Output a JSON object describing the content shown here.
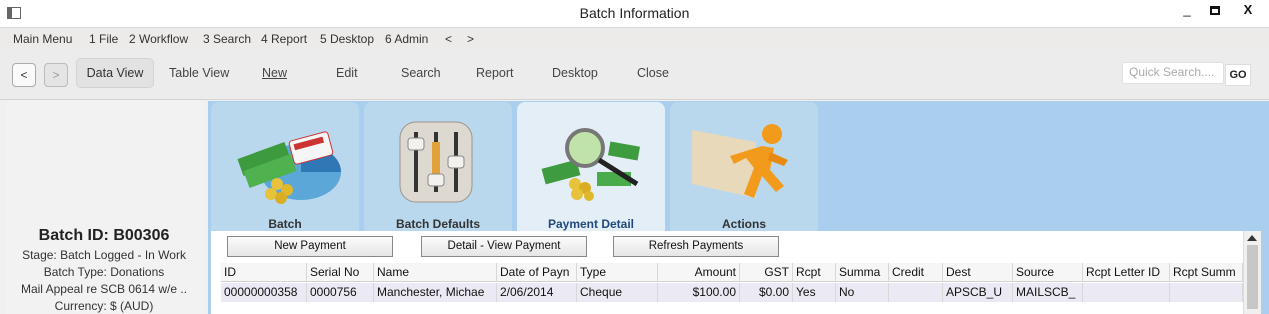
{
  "window": {
    "title": "Batch Information",
    "minimize": "_",
    "close": "X"
  },
  "menu": [
    "Main Menu",
    "1 File",
    "2 Workflow",
    "3 Search",
    "4 Report",
    "5 Desktop",
    "6 Admin",
    "<",
    ">"
  ],
  "toolbar": {
    "back": "<",
    "forward": ">",
    "data_view": "Data View",
    "table_view": "Table View",
    "new": "New",
    "edit": "Edit",
    "search": "Search",
    "report": "Report",
    "desktop": "Desktop",
    "close": "Close",
    "quick_search_placeholder": "Quick Search....",
    "go": "GO"
  },
  "batch_summary": {
    "batch_id": "Batch ID: B00306",
    "stage": "Stage: Batch Logged - In Work",
    "batch_type": "Batch Type: Donations",
    "description": "Mail Appeal re SCB 0614 w/e ..",
    "currency": "Currency: $ (AUD)"
  },
  "tabs": [
    {
      "label": "Batch",
      "icon": "money-card-icon"
    },
    {
      "label": "Batch Defaults",
      "icon": "sliders-icon"
    },
    {
      "label": "Payment Detail",
      "icon": "magnifier-money-icon",
      "active": true
    },
    {
      "label": "Actions",
      "icon": "running-man-icon"
    }
  ],
  "actions": {
    "new_payment": "New Payment",
    "detail_view": "Detail - View Payment",
    "refresh": "Refresh Payments"
  },
  "grid": {
    "columns": [
      "ID",
      "Serial No",
      "Name",
      "Date of Payn",
      "Type",
      "Amount",
      "GST",
      "Rcpt",
      "Summa",
      "Credit",
      "Dest",
      "Source",
      "Rcpt Letter ID",
      "Rcpt Summ"
    ],
    "rows": [
      [
        "00000000358",
        "0000756",
        "Manchester, Michae",
        "2/06/2014",
        "Cheque",
        "$100.00",
        "$0.00",
        "Yes",
        "No",
        "",
        "APSCB_U",
        "MAILSCB_",
        "",
        ""
      ]
    ]
  },
  "colors": {
    "main_bg": "#aacfee",
    "tab_bg": "#b9d8ee",
    "tab_active_bg": "#e4eef7",
    "active_tab_text": "#1f4a7a"
  }
}
